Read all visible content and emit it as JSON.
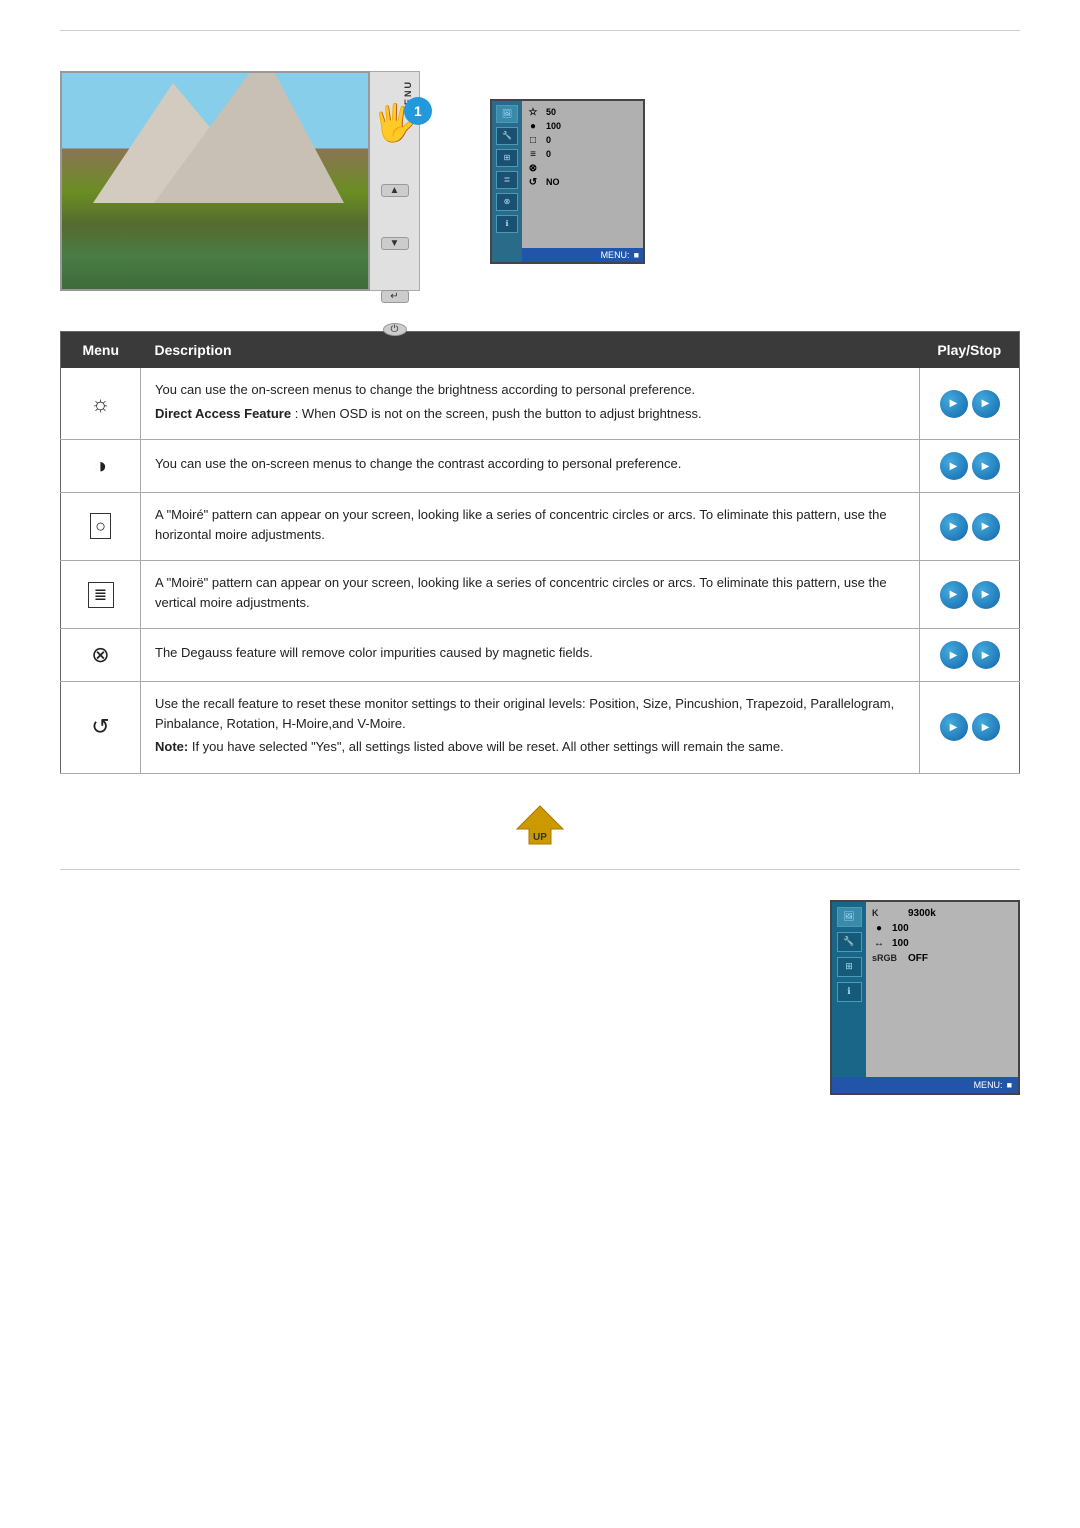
{
  "top_divider": true,
  "monitor": {
    "step_number": "1",
    "menu_label": "MENU",
    "buttons": {
      "up": "▲",
      "down": "▼",
      "enter": "↵",
      "power": "⏻"
    },
    "osd": {
      "rows": [
        {
          "icon": "☆",
          "value": "50"
        },
        {
          "icon": "●",
          "value": "100"
        },
        {
          "icon": "□",
          "value": "0"
        },
        {
          "icon": "≡",
          "value": "0"
        },
        {
          "icon": "⊗",
          "value": ""
        },
        {
          "icon": "↺",
          "value": "NO"
        }
      ],
      "bottom_label": "MENU:",
      "bottom_icon": "■"
    }
  },
  "table": {
    "headers": {
      "menu": "Menu",
      "description": "Description",
      "playstop": "Play/Stop"
    },
    "rows": [
      {
        "symbol": "☼",
        "symbol_type": "brightness",
        "description_main": "You can use the on-screen menus to change the brightness according to personal preference.",
        "description_extra": "Direct Access Feature : When OSD is not on the screen, push the button to adjust brightness.",
        "extra_bold_part": "Direct Access Feature",
        "has_note": false
      },
      {
        "symbol": "◑",
        "symbol_type": "contrast",
        "description_main": "You can use the on-screen menus to change the contrast according to personal preference.",
        "description_extra": "",
        "has_note": false
      },
      {
        "symbol": "⊙",
        "symbol_type": "hmoire",
        "description_main": "A \"Moiré\" pattern can appear on your screen, looking like a series of concentric circles or arcs. To eliminate this pattern, use the horizontal moire adjustments.",
        "description_extra": "",
        "has_note": false
      },
      {
        "symbol": "≣",
        "symbol_type": "vmoire",
        "description_main": "A \"Moirë\" pattern can appear on your screen, looking like a series of concentric circles or arcs. To eliminate this pattern, use the vertical moire adjustments.",
        "description_extra": "",
        "has_note": false
      },
      {
        "symbol": "⊗",
        "symbol_type": "degauss",
        "description_main": "The Degauss feature will remove color impurities caused by magnetic fields.",
        "description_extra": "",
        "has_note": false
      },
      {
        "symbol": "↺",
        "symbol_type": "recall",
        "description_main": "Use the recall feature to reset these monitor settings to their original levels: Position, Size, Pincushion, Trapezoid, Parallelogram, Pinbalance, Rotation, H-Moire,and V-Moire.",
        "description_extra": "Note: If you have selected \"Yes\", all settings listed above will be reset. All other settings will remain the same.",
        "note_bold_part": "Note:",
        "has_note": true
      }
    ]
  },
  "up_button": {
    "label": "UP"
  },
  "bottom_osd": {
    "rows": [
      {
        "icon": "K",
        "label": "9300k"
      },
      {
        "icon": "●",
        "value": "100"
      },
      {
        "icon": "↔",
        "value": "100"
      },
      {
        "label": "sRGB",
        "value": "OFF"
      }
    ],
    "bottom_label": "MENU:",
    "bottom_icon": "■"
  }
}
